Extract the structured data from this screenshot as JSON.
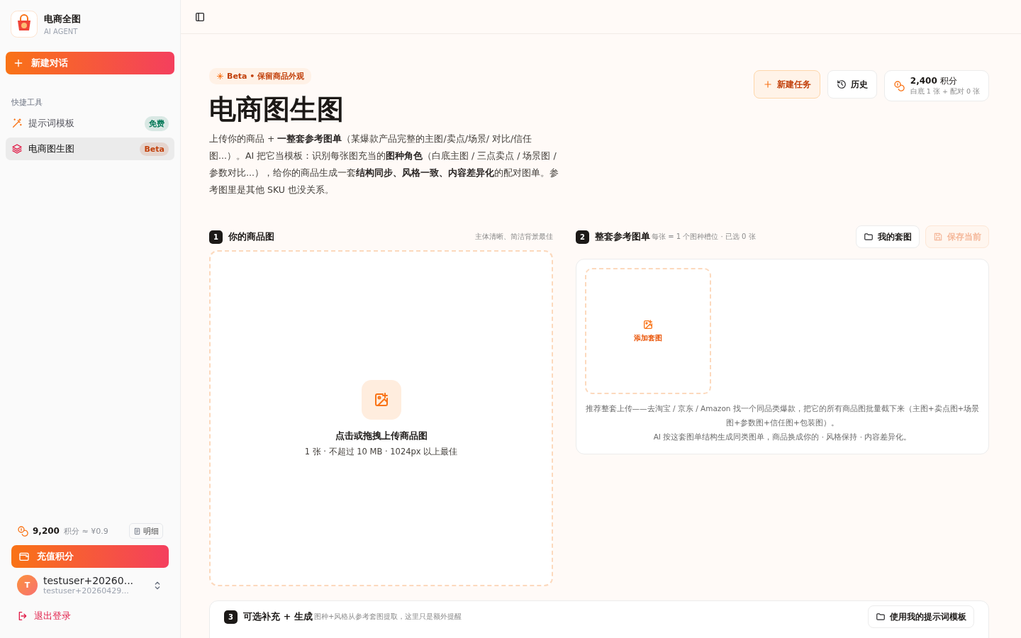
{
  "brand": {
    "name": "电商全图",
    "subtitle": "AI AGENT"
  },
  "new_chat_button": "新建对话",
  "sidebar": {
    "section_title": "快捷工具",
    "items": [
      {
        "label": "提示词模板",
        "badge": "免费",
        "color": "#047857",
        "selected": false
      },
      {
        "label": "电商图生图",
        "badge": "Beta",
        "color": "#c2410c",
        "selected": true
      }
    ]
  },
  "credits": {
    "amount": "9,200",
    "note": "积分 ≈ ¥0.9",
    "detail_button": "明细"
  },
  "recharge_button": "充值积分",
  "user": {
    "avatar": "T",
    "name": "testuser+20260...",
    "email": "testuser+20260429..."
  },
  "logout": "退出登录",
  "page": {
    "tag": "Beta • 保留商品外观",
    "title": "电商图生图",
    "description": "上传你的商品 + **一整套参考图单**（某爆款产品完整的主图/卖点/场景/ 对比/信任图...）。AI 把它当模板：识别每张图充当的**图种角色**（白底主图 / 三点卖点 / 场景图 / 参数对比...），给你的商品生成一套**结构同步、风格一致、内容差异化**的配对图单。参考图里是其他 SKU 也没关系。",
    "actions": [
      {
        "label": "新建任务",
        "kind": "primary"
      },
      {
        "label": "历史",
        "kind": "plain"
      }
    ],
    "cost": {
      "amount": "2,400",
      "unit": "积分",
      "detail": "白底 1 张 + 配对 0 张"
    }
  },
  "step1": {
    "number": "1",
    "title": "你的商品图",
    "hint": "主体清晰、简洁背景最佳",
    "upload_title": "点击或拖拽上传商品图",
    "upload_hint": "1 张 · 不超过 10 MB · 1024px 以上最佳"
  },
  "step2": {
    "number": "2",
    "title": "整套参考图单",
    "hint": "每张 = 1 个图种槽位 · 已选 0 张",
    "buttons": [
      {
        "label": "我的套图",
        "disabled": false
      },
      {
        "label": "保存当前",
        "disabled": true
      }
    ],
    "add_tile": "添加套图",
    "notes": [
      "推荐整套上传——去淘宝 / 京东 / Amazon 找一个同品类爆款，把它的所有商品图批量截下来（主图+卖点图+场景图+参数图+信任图+包装图）。",
      "AI 按这套图单结构生成同类图单，商品换成你的 · 风格保持 · 内容差异化。"
    ]
  },
  "step3": {
    "number": "3",
    "title": "可选补充 + 生成",
    "hint": "图种+风格从参考套图提取，这里只是额外提醒",
    "button": "使用我的提示词模板"
  }
}
